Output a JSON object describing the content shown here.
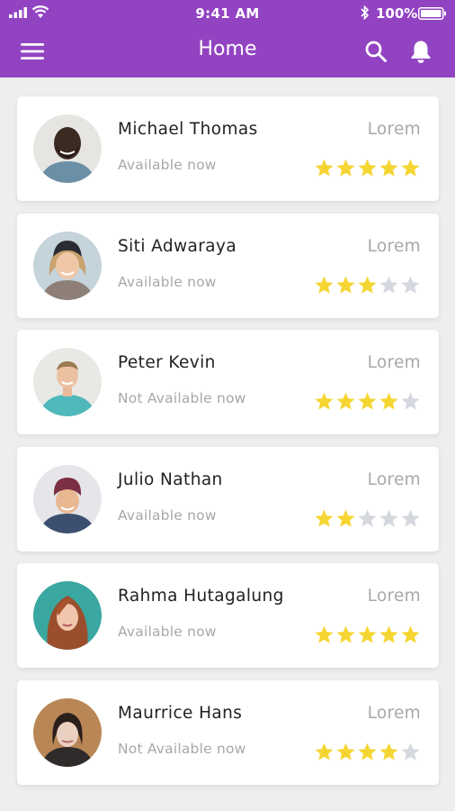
{
  "status_bar": {
    "time": "9:41 AM",
    "battery": "100%"
  },
  "header": {
    "title": "Home",
    "menu_icon": "menu-icon",
    "search_icon": "search-icon",
    "bell_icon": "bell-icon",
    "color": "#9243c2"
  },
  "colors": {
    "star_filled": "#f5d531",
    "star_empty": "#d5d8de"
  },
  "contacts": [
    {
      "name": "Michael Thomas",
      "status": "Available now",
      "tag": "Lorem",
      "rating": 5
    },
    {
      "name": "Siti Adwaraya",
      "status": "Available now",
      "tag": "Lorem",
      "rating": 3
    },
    {
      "name": "Peter Kevin",
      "status": "Not Available now",
      "tag": "Lorem",
      "rating": 4
    },
    {
      "name": "Julio Nathan",
      "status": "Available now",
      "tag": "Lorem",
      "rating": 2
    },
    {
      "name": "Rahma Hutagalung",
      "status": "Available now",
      "tag": "Lorem",
      "rating": 5
    },
    {
      "name": "Maurrice Hans",
      "status": "Not Available now",
      "tag": "Lorem",
      "rating": 4
    }
  ]
}
